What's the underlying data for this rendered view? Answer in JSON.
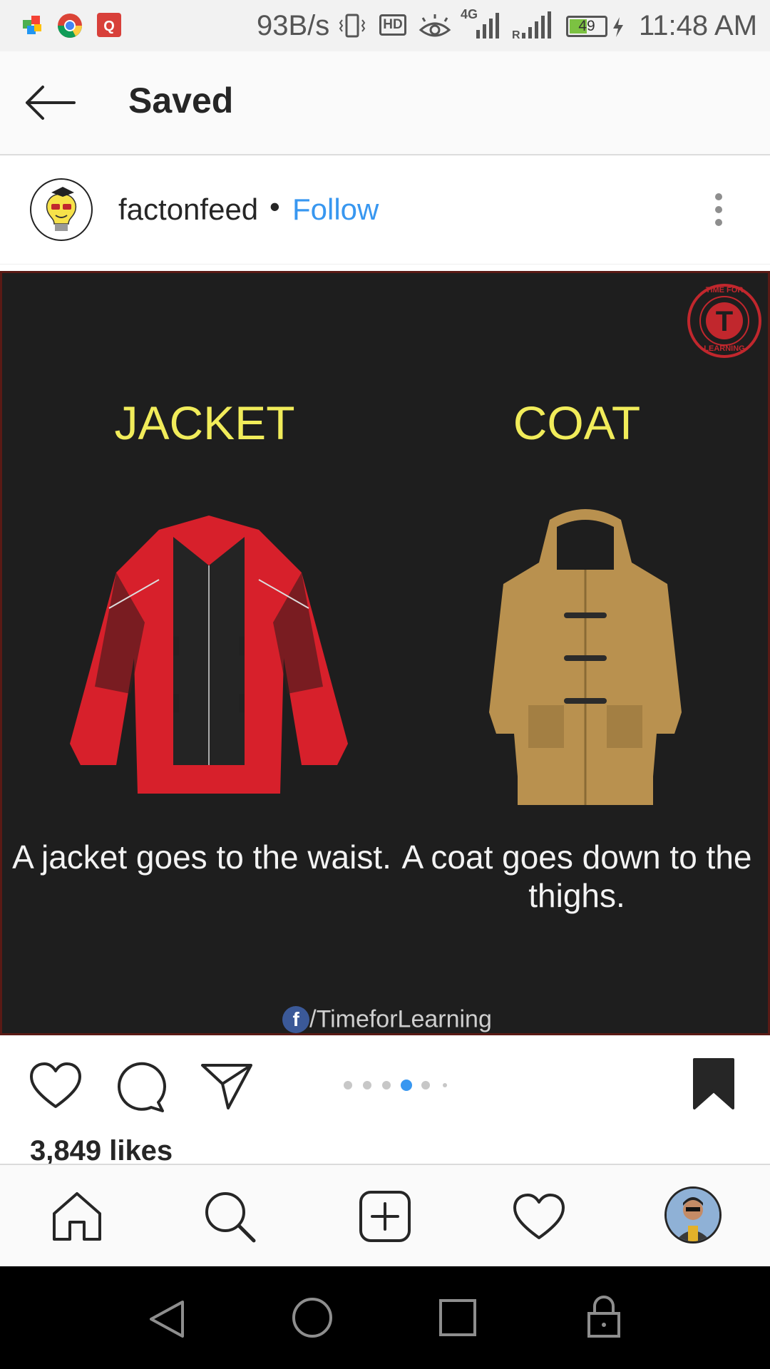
{
  "status_bar": {
    "speed": "93B/s",
    "hd": "HD",
    "network": "4G",
    "battery": "49",
    "time": "11:48 AM"
  },
  "header": {
    "title": "Saved"
  },
  "post": {
    "username": "factonfeed",
    "separator": "•",
    "follow_label": "Follow",
    "image": {
      "left_title": "JACKET",
      "left_caption": "A jacket goes to the waist.",
      "right_title": "COAT",
      "right_caption": "A coat goes down to the thighs.",
      "credit": "/TimeforLearning",
      "credit_icon": "f",
      "badge": {
        "letter": "T",
        "top": "TIME FOR",
        "bottom": "LEARNING"
      }
    },
    "carousel": {
      "count": 6,
      "active_index": 3
    },
    "likes": "3,849 likes"
  },
  "colors": {
    "follow": "#3897f0",
    "title_yellow": "#f1ec5a",
    "jacket_red": "#d7202b",
    "coat_tan": "#b9914f",
    "badge_red": "#c1272d"
  },
  "icons": {
    "back": "arrow-left-icon",
    "more": "more-vertical-icon",
    "like": "heart-icon",
    "comment": "comment-icon",
    "share": "send-icon",
    "save": "bookmark-icon",
    "home": "home-icon",
    "search": "search-icon",
    "add": "add-post-icon",
    "activity": "heart-icon",
    "profile": "profile-avatar"
  }
}
